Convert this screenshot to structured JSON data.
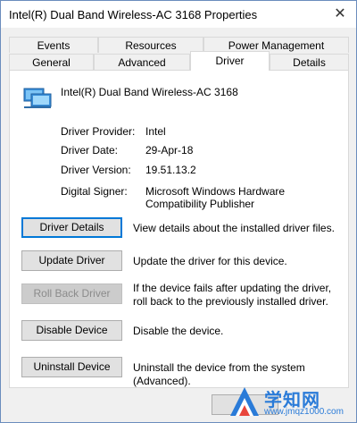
{
  "window": {
    "title": "Intel(R) Dual Band Wireless-AC 3168 Properties"
  },
  "tabs_top": [
    "Events",
    "Resources",
    "Power Management"
  ],
  "tabs_bottom": [
    "General",
    "Advanced",
    "Driver",
    "Details"
  ],
  "active_tab": "Driver",
  "device": {
    "name": "Intel(R) Dual Band Wireless-AC 3168",
    "icon": "network-adapter-icon"
  },
  "info": [
    {
      "label": "Driver Provider:",
      "value": "Intel"
    },
    {
      "label": "Driver Date:",
      "value": "29-Apr-18"
    },
    {
      "label": "Driver Version:",
      "value": "19.51.13.2"
    },
    {
      "label": "Digital Signer:",
      "value": "Microsoft Windows Hardware Compatibility Publisher"
    }
  ],
  "actions": [
    {
      "button": "Driver Details",
      "desc": "View details about the installed driver files."
    },
    {
      "button": "Update Driver",
      "desc": "Update the driver for this device."
    },
    {
      "button": "Roll Back Driver",
      "desc": "If the device fails after updating the driver, roll back to the previously installed driver."
    },
    {
      "button": "Disable Device",
      "desc": "Disable the device."
    },
    {
      "button": "Uninstall Device",
      "desc": "Uninstall the device from the system (Advanced)."
    }
  ],
  "watermark": {
    "text": "学知网",
    "url": "www.jmqz1000.com"
  }
}
